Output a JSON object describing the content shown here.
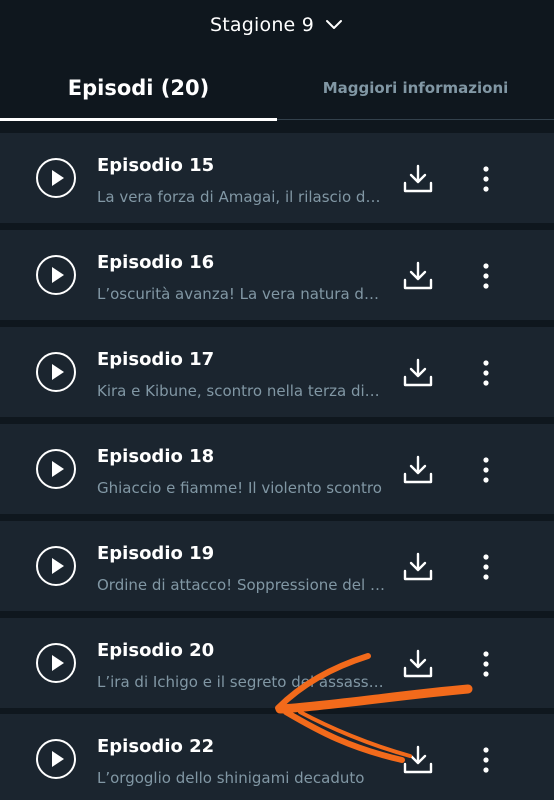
{
  "season": {
    "label": "Stagione 9",
    "chevron_icon": "chevron-down-icon"
  },
  "tabs": [
    {
      "label": "Episodi (20)",
      "active": true
    },
    {
      "label": "Maggiori informazioni",
      "active": false
    }
  ],
  "episodes": [
    {
      "title": "Episodio 15",
      "description": "La vera forza di Amagai, il rilascio dello zanpakuto"
    },
    {
      "title": "Episodio 16",
      "description": "L’oscurità avanza! La vera natura del clan Kasumioji"
    },
    {
      "title": "Episodio 17",
      "description": "Kira e Kibune, scontro nella terza divisione"
    },
    {
      "title": "Episodio 18",
      "description": "Ghiaccio e fiamme! Il violento scontro"
    },
    {
      "title": "Episodio 19",
      "description": "Ordine di attacco! Soppressione del clan Kasumioji"
    },
    {
      "title": "Episodio 20",
      "description": "L’ira di Ichigo e il segreto del assassino"
    },
    {
      "title": "Episodio 22",
      "description": "L’orgoglio dello shinigami decaduto"
    }
  ],
  "icons": {
    "play": "play-icon",
    "download": "download-icon",
    "more": "more-vertical-icon"
  },
  "colors": {
    "background": "#0f171e",
    "row": "#1b252f",
    "secondary_text": "#8197a4",
    "annotation": "#f26a1b"
  }
}
